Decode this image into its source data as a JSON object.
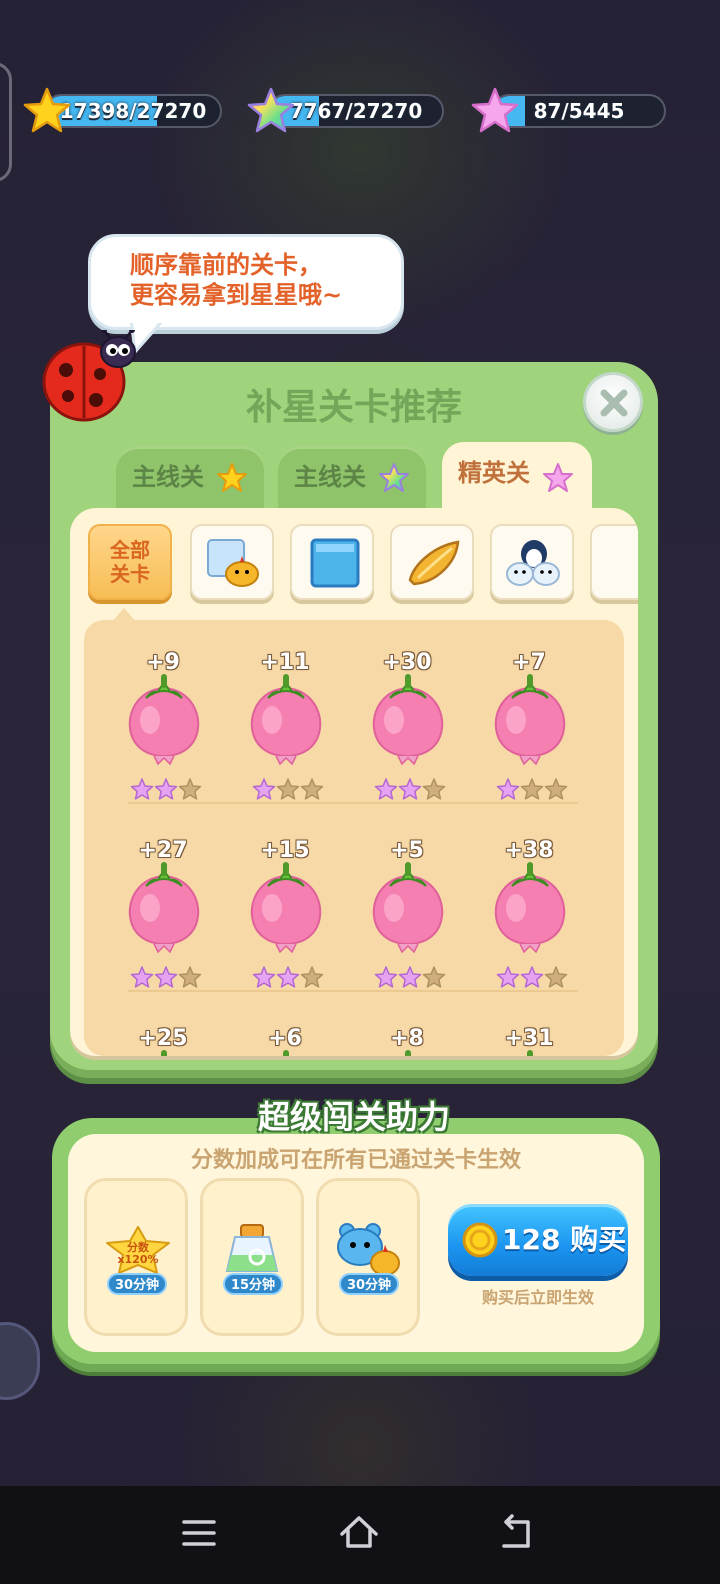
{
  "resources": [
    {
      "label": "17398/27270",
      "fraction": 0.638,
      "color": "#45b8f2",
      "icon": "yellow-star-icon"
    },
    {
      "label": "7767/27270",
      "fraction": 0.285,
      "color": "#45b8f2",
      "icon": "rainbow-star-icon"
    },
    {
      "label": "87/5445",
      "fraction": 0.016,
      "color": "#45b8f2",
      "icon": "pink-star-icon"
    }
  ],
  "bubble": {
    "line1": "顺序靠前的关卡，",
    "line2": "更容易拿到星星哦~"
  },
  "panel": {
    "title": "补星关卡推荐",
    "tabs": [
      {
        "label": "主线关",
        "icon": "yellow-star-icon",
        "active": false
      },
      {
        "label": "主线关",
        "icon": "rainbow-star-icon",
        "active": false
      },
      {
        "label": "精英关",
        "icon": "pink-star-icon",
        "active": true
      }
    ],
    "filters": [
      {
        "label": "全部\n关卡",
        "line1": "全部",
        "line2": "关卡",
        "icon": "none",
        "active": true
      },
      {
        "icon": "ice-block-chick-icon",
        "active": false
      },
      {
        "icon": "ice-block-icon",
        "active": false
      },
      {
        "icon": "golden-seed-icon",
        "active": false
      },
      {
        "icon": "penguin-friends-icon",
        "active": false
      }
    ],
    "levels": [
      {
        "plus": "+9",
        "stars": 2
      },
      {
        "plus": "+11",
        "stars": 1
      },
      {
        "plus": "+30",
        "stars": 2
      },
      {
        "plus": "+7",
        "stars": 1
      },
      {
        "plus": "+27",
        "stars": 2
      },
      {
        "plus": "+15",
        "stars": 2
      },
      {
        "plus": "+5",
        "stars": 2
      },
      {
        "plus": "+38",
        "stars": 2
      },
      {
        "plus": "+25",
        "stars": 0
      },
      {
        "plus": "+6",
        "stars": 0
      },
      {
        "plus": "+8",
        "stars": 0
      },
      {
        "plus": "+31",
        "stars": 0
      }
    ]
  },
  "boost": {
    "title": "超级闯关助力",
    "subtitle": "分数加成可在所有已通过关卡生效",
    "cards": [
      {
        "badge_line1": "分数",
        "badge_line2": "x120%",
        "duration": "30分钟",
        "icon": "score-star-badge-icon"
      },
      {
        "duration": "15分钟",
        "icon": "potion-bottle-icon"
      },
      {
        "duration": "30分钟",
        "icon": "bear-chick-icon"
      }
    ],
    "buy_label": "128 购买",
    "buy_note": "购买后立即生效"
  },
  "colors": {
    "accent_green": "#a0d47c",
    "cream": "#fff4d6",
    "orange_text": "#d9661e",
    "buy_blue": "#1a94f0"
  }
}
